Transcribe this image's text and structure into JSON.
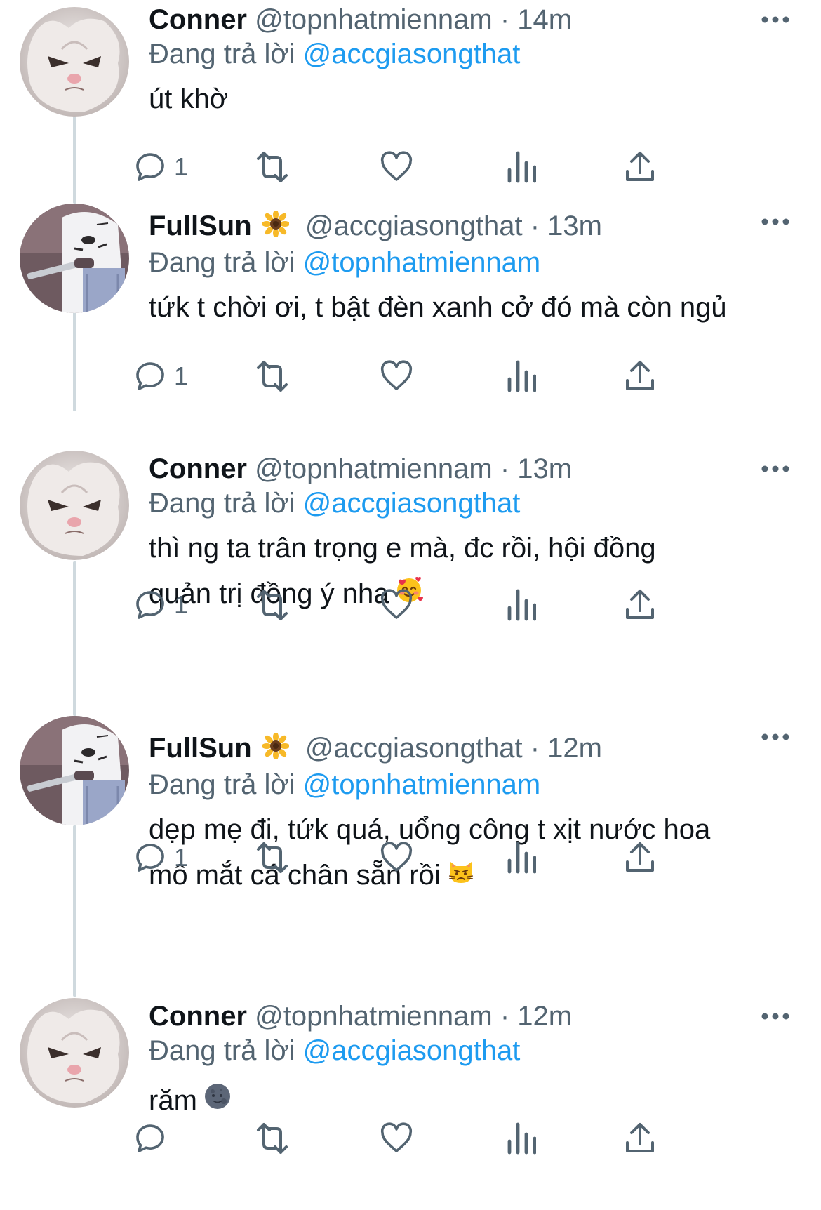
{
  "tweets": [
    {
      "name": "Conner",
      "handle": "@topnhatmiennam",
      "dot": "·",
      "time": "14m",
      "reply_prefix": "Đang trả lời",
      "reply_to": "@accgiasongthat",
      "lines": [
        "út khờ"
      ],
      "reply_count": "1"
    },
    {
      "name": "FullSun",
      "handle": "@accgiasongthat",
      "dot": "·",
      "time": "13m",
      "reply_prefix": "Đang trả lời",
      "reply_to": "@topnhatmiennam",
      "lines": [
        "tứk t chời ơi, t bật đèn xanh cở đó mà còn ngủ"
      ],
      "reply_count": "1"
    },
    {
      "name": "Conner",
      "handle": "@topnhatmiennam",
      "dot": "·",
      "time": "13m",
      "reply_prefix": "Đang trả lời",
      "reply_to": "@accgiasongthat",
      "lines": [
        "thì ng ta trân trọng e mà, đc rồi, hội đồng",
        "quản trị đồng ý nha"
      ],
      "reply_count": "1"
    },
    {
      "name": "FullSun",
      "handle": "@accgiasongthat",
      "dot": "·",
      "time": "12m",
      "reply_prefix": "Đang trả lời",
      "reply_to": "@topnhatmiennam",
      "lines": [
        "dẹp mẹ đi, tứk quá, uổng công t xịt nước hoa",
        "mô mắt cá chân sẵn rồi"
      ],
      "reply_count": "1"
    },
    {
      "name": "Conner",
      "handle": "@topnhatmiennam",
      "dot": "·",
      "time": "12m",
      "reply_prefix": "Đang trả lời",
      "reply_to": "@accgiasongthat",
      "lines": [
        "răm"
      ],
      "reply_count": ""
    }
  ],
  "icons": {
    "reply": "reply-icon",
    "retweet": "retweet-icon",
    "like": "heart-icon",
    "views": "analytics-icon",
    "share": "share-icon",
    "more": "more-icon",
    "sunflower": "sunflower-emoji",
    "smiling_hearts": "smiling-face-with-hearts-emoji",
    "pouting_cat": "pouting-cat-emoji",
    "new_moon_face": "new-moon-face-emoji"
  },
  "colors": {
    "text_primary": "#0f1419",
    "text_secondary": "#536471",
    "link": "#1d9bf0",
    "thread_line": "#cfd9de"
  }
}
